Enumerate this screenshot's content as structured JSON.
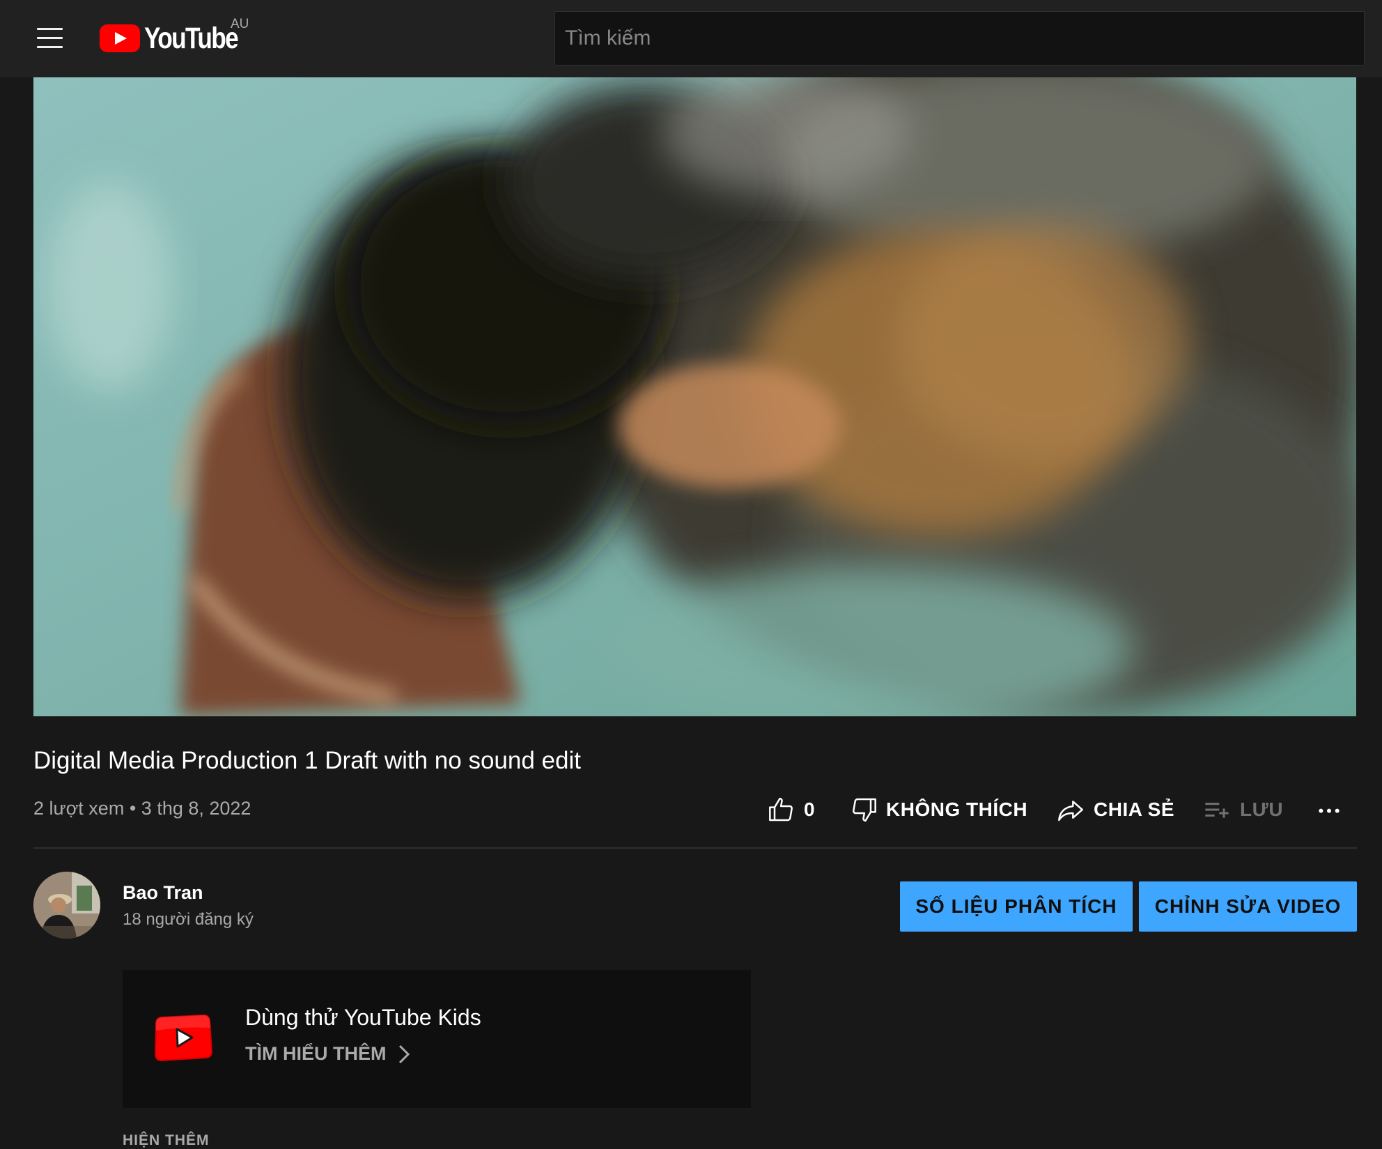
{
  "header": {
    "logo_text": "YouTube",
    "region": "AU",
    "search_placeholder": "Tìm kiếm"
  },
  "video": {
    "title": "Digital Media Production 1 Draft with no sound edit",
    "views": "2 lượt xem",
    "separator": "•",
    "date": "3 thg 8, 2022"
  },
  "actions": {
    "like_count": "0",
    "dislike_label": "KHÔNG THÍCH",
    "share_label": "CHIA SẺ",
    "save_label": "LƯU"
  },
  "channel": {
    "name": "Bao Tran",
    "subscribers": "18 người đăng ký",
    "analytics_button": "SỐ LIỆU PHÂN TÍCH",
    "edit_button": "CHỈNH SỬA VIDEO"
  },
  "promo": {
    "title": "Dùng thử YouTube Kids",
    "link": "TÌM HIỂU THÊM"
  },
  "description": {
    "show_more": "HIỆN THÊM"
  },
  "colors": {
    "background": "#181818",
    "topbar": "#212121",
    "accent_blue": "#3ea6ff",
    "brand_red": "#ff0000"
  },
  "icons": {
    "menu": "hamburger-icon",
    "like": "thumbs-up-icon",
    "dislike": "thumbs-down-icon",
    "share": "share-arrow-icon",
    "save": "playlist-add-icon",
    "more": "more-horizontal-icon",
    "promo_chevron": "chevron-right-icon"
  }
}
